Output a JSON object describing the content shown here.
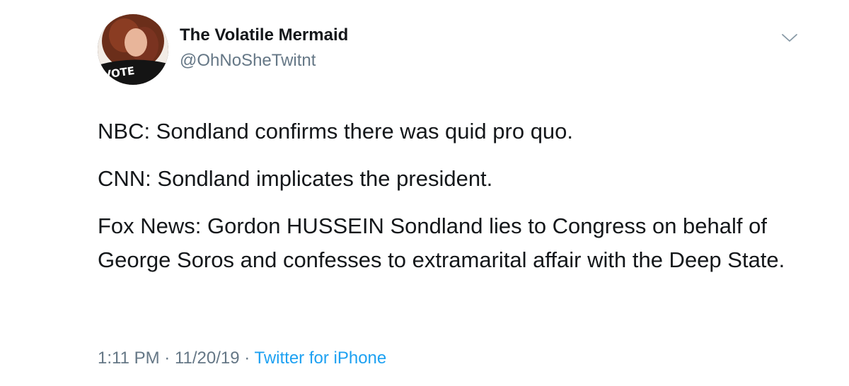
{
  "user": {
    "display_name": "The Volatile Mermaid",
    "handle": "@OhNoSheTwitnt",
    "avatar_shirt_text": "VOTE"
  },
  "tweet": {
    "lines": [
      "NBC: Sondland confirms there was quid pro quo.",
      "CNN: Sondland implicates the president.",
      "Fox News: Gordon HUSSEIN Sondland lies to Congress on behalf of George Soros and confesses to extramarital affair with the Deep State."
    ]
  },
  "meta": {
    "time": "1:11 PM",
    "separator1": " · ",
    "date": "11/20/19",
    "separator2": " · ",
    "source": "Twitter for iPhone"
  },
  "icons": {
    "menu": "chevron-down-icon"
  },
  "colors": {
    "text": "#14171a",
    "secondary": "#657786",
    "link": "#1da1f2"
  }
}
